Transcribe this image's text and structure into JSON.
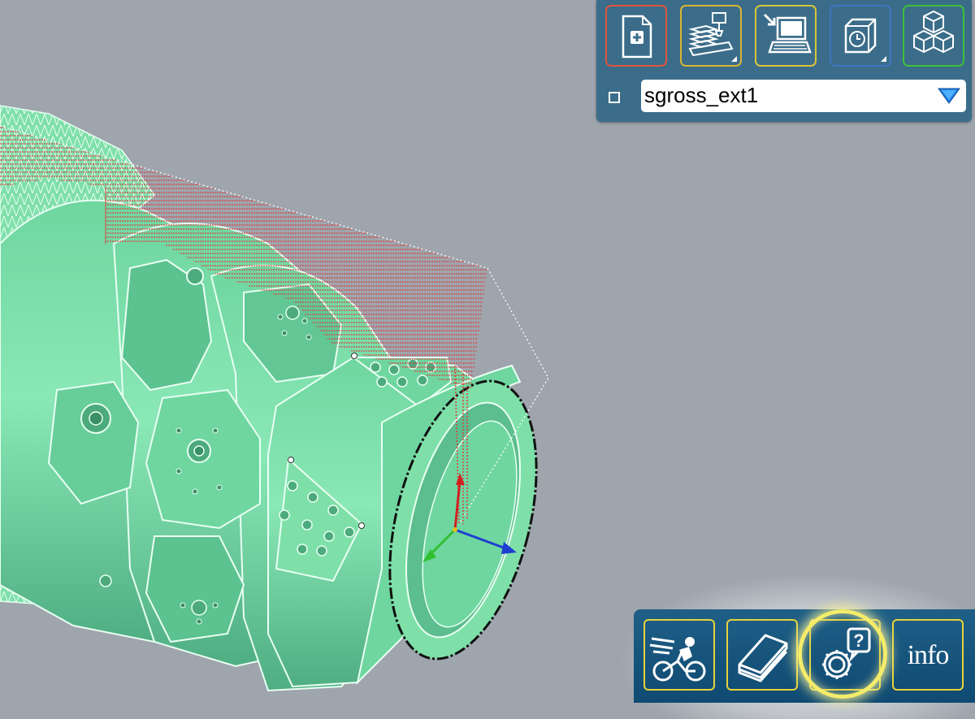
{
  "toolbar_top": {
    "buttons": [
      {
        "name": "new-document",
        "icon": "new-document-icon",
        "border_color": "#e0553a"
      },
      {
        "name": "machine-setup",
        "icon": "machine-stack-icon",
        "border_color": "#d9b533",
        "has_dropdown": true
      },
      {
        "name": "import-computer",
        "icon": "computer-import-icon",
        "border_color": "#d9c537"
      },
      {
        "name": "timer",
        "icon": "clock-cube-icon",
        "border_color": "#3f73c2",
        "has_dropdown": true
      },
      {
        "name": "stock-blocks",
        "icon": "cubes-icon",
        "border_color": "#3fbf3a"
      }
    ],
    "selector": {
      "value": "sgross_ext1",
      "checked": false
    }
  },
  "toolbar_bottom": {
    "buttons": [
      {
        "name": "speed",
        "icon": "cyclist-speed-icon"
      },
      {
        "name": "manual",
        "icon": "book-icon"
      },
      {
        "name": "help-settings",
        "icon": "gear-question-icon",
        "highlighted": true
      },
      {
        "name": "info",
        "icon": "info-icon",
        "label": "info"
      }
    ],
    "border_color": "#e7d33a"
  },
  "viewport": {
    "background": "#9ea5ad",
    "part_color": "#7ee0a8",
    "toolpath_color": "#d94040",
    "axis_colors": {
      "x": "#1f3fd0",
      "y": "#2fbf2f",
      "z": "#d02020"
    }
  }
}
